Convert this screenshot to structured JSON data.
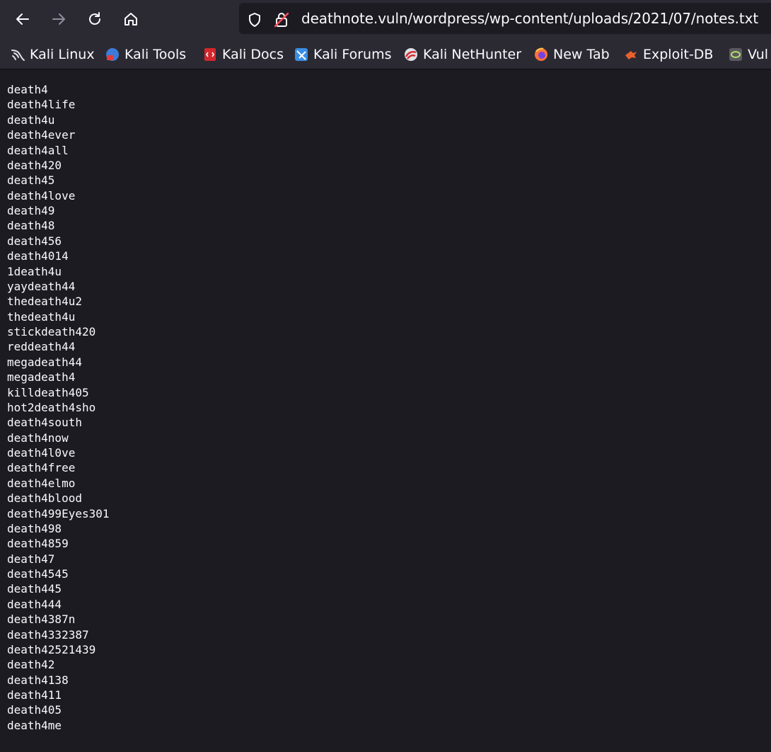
{
  "browser": {
    "url": "deathnote.vuln/wordpress/wp-content/uploads/2021/07/notes.txt",
    "nav": {
      "back": "arrow-left-icon",
      "forward": "arrow-right-icon",
      "reload": "reload-icon",
      "home": "home-icon"
    },
    "colors": {
      "toolbar": "#2b2a33",
      "page_bg": "#1c1b22",
      "text": "#fbfbfe"
    }
  },
  "bookmarks": [
    {
      "label": "Kali Linux",
      "icon": "kali-dragon-icon"
    },
    {
      "label": "Kali Tools",
      "icon": "kali-tools-icon"
    },
    {
      "label": "Kali Docs",
      "icon": "kali-docs-icon"
    },
    {
      "label": "Kali Forums",
      "icon": "kali-forums-icon"
    },
    {
      "label": "Kali NetHunter",
      "icon": "kali-nethunter-icon"
    },
    {
      "label": "New Tab",
      "icon": "firefox-icon"
    },
    {
      "label": "Exploit-DB",
      "icon": "exploit-db-icon"
    },
    {
      "label": "Vul",
      "icon": "vulnhub-icon"
    }
  ],
  "file": {
    "lines": [
      "death4",
      "death4life",
      "death4u",
      "death4ever",
      "death4all",
      "death420",
      "death45",
      "death4love",
      "death49",
      "death48",
      "death456",
      "death4014",
      "1death4u",
      "yaydeath44",
      "thedeath4u2",
      "thedeath4u",
      "stickdeath420",
      "reddeath44",
      "megadeath44",
      "megadeath4",
      "killdeath405",
      "hot2death4sho",
      "death4south",
      "death4now",
      "death4l0ve",
      "death4free",
      "death4elmo",
      "death4blood",
      "death499Eyes301",
      "death498",
      "death4859",
      "death47",
      "death4545",
      "death445",
      "death444",
      "death4387n",
      "death4332387",
      "death42521439",
      "death42",
      "death4138",
      "death411",
      "death405",
      "death4me"
    ]
  }
}
